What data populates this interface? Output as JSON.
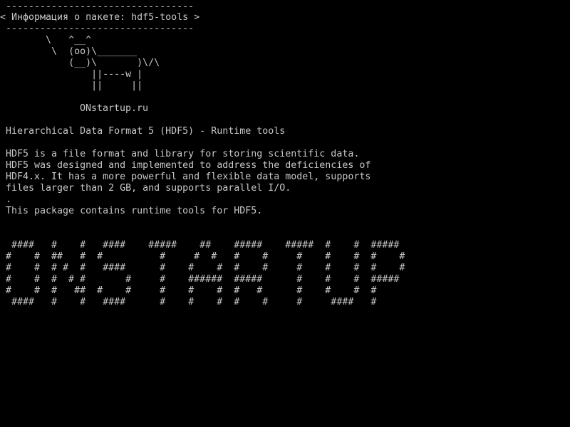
{
  "terminal": {
    "colors": {
      "background": "#000000",
      "foreground": "#c8c8c8"
    },
    "cowsay": {
      "border_top": " ---------------------------------",
      "title_line": "< Информация о пакете: hdf5-tools >",
      "border_bottom": " ---------------------------------",
      "cow": [
        "        \\   ^__^",
        "         \\  (oo)\\_______",
        "            (__)\\       )\\/\\",
        "                ||----w |",
        "                ||     ||"
      ],
      "site": "ONstartup.ru"
    },
    "package_info": {
      "summary": "Hierarchical Data Format 5 (HDF5) - Runtime tools",
      "description": [
        "HDF5 is a file format and library for storing scientific data.",
        "HDF5 was designed and implemented to address the deficiencies of",
        "HDF4.x. It has a more powerful and flexible data model, supports",
        "files larger than 2 GB, and supports parallel I/O."
      ],
      "separator": ".",
      "note": "This package contains runtime tools for HDF5."
    },
    "banner": [
      " ####   #    #   ####    #####    ##    #####    #####  #    #  #####",
      "#    #  ##   #  #          #     #  #   #    #     #    #    #  #    #",
      "#    #  # #  #   ####      #    #    #  #    #     #    #    #  #    #",
      "#    #  #  # #       #     #    ######  #####      #    #    #  #####",
      "#    #  #   ##  #    #     #    #    #  #   #      #    #    #  #",
      " ####   #    #   ####      #    #    #  #    #     #     ####   #"
    ]
  }
}
